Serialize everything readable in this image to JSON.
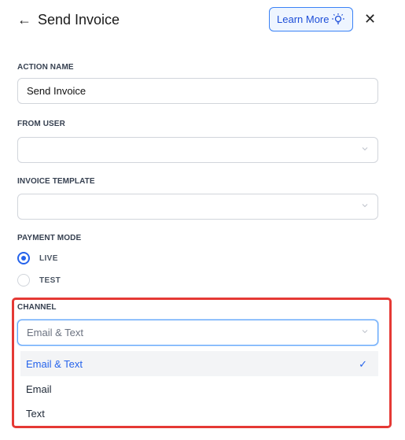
{
  "header": {
    "title": "Send Invoice",
    "learn_more": "Learn More"
  },
  "action_name": {
    "label": "ACTION NAME",
    "value": "Send Invoice"
  },
  "from_user": {
    "label": "FROM USER",
    "value": ""
  },
  "invoice_template": {
    "label": "INVOICE TEMPLATE",
    "value": ""
  },
  "payment_mode": {
    "label": "PAYMENT MODE",
    "options": [
      {
        "label": "LIVE",
        "selected": true
      },
      {
        "label": "TEST",
        "selected": false
      }
    ]
  },
  "channel": {
    "label": "CHANNEL",
    "value": "Email & Text",
    "options": [
      {
        "label": "Email & Text",
        "selected": true
      },
      {
        "label": "Email",
        "selected": false
      },
      {
        "label": "Text",
        "selected": false
      }
    ]
  },
  "colors": {
    "accent": "#2563eb",
    "highlight": "#e53935"
  },
  "icons": [
    "arrow-left-icon",
    "lightbulb-icon",
    "close-icon",
    "chevron-down-icon",
    "check-icon"
  ]
}
